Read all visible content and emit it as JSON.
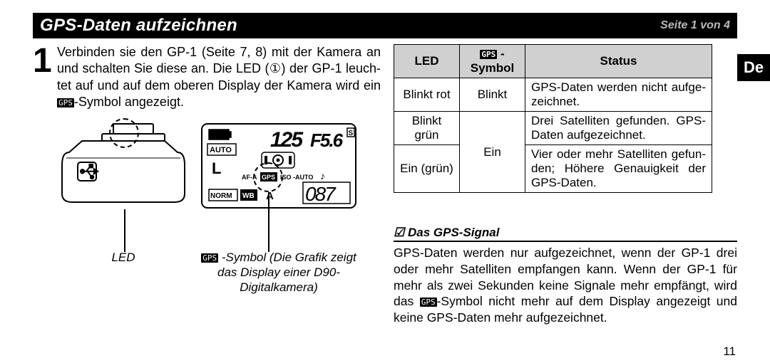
{
  "header": {
    "title": "GPS-Daten aufzeichnen",
    "page_indicator": "Seite 1 von 4"
  },
  "lang_tab": "De",
  "step": {
    "number": "1",
    "text": "Verbinden sie den GP-1 (Seite 7, 8) mit der Kamera an und schalten Sie diese an. Die LED (①) der GP-1 leuch­tet auf und auf dem oberen Display der Kamera wird ein ",
    "text_after": "-Symbol angezeigt."
  },
  "captions": {
    "led": "LED",
    "lcd": " -Symbol (Die Grafik zeigt das Display einer D90-Digitalkamera)"
  },
  "table": {
    "headers": {
      "led": "LED",
      "symbol": " -Symbol",
      "status": "Status"
    },
    "rows": [
      {
        "led": "Blinkt rot",
        "symbol": "Blinkt",
        "status": "GPS-Daten werden nicht aufge­zeichnet."
      },
      {
        "led": "Blinkt grün",
        "symbol": "Ein",
        "status": "Drei Satelliten gefunden. GPS-Daten aufgezeichnet."
      },
      {
        "led": "Ein (grün)",
        "symbol": "",
        "status": "Vier oder mehr Satelliten gefun­den; Höhere Genauigkeit der GPS-Daten."
      }
    ]
  },
  "note": {
    "title": " Das GPS-Signal",
    "body_before": "GPS-Daten werden nur aufgezeichnet, wenn der GP-1 drei oder mehr Satelliten empfangen kann. Wenn der GP-1 für mehr als zwei Sekunden keine Signale mehr empfängt, wird das ",
    "body_after": "-Symbol nicht mehr auf dem Display angezeigt und keine GPS-Daten mehr aufgezeichnet."
  },
  "page_number": "11",
  "icons": {
    "gps_chip": "GPS",
    "check": "☑"
  },
  "chart_data": {
    "type": "table",
    "title": "GPS LED/Symbol status",
    "columns": [
      "LED",
      "GPS-Symbol",
      "Status"
    ],
    "rows": [
      [
        "Blinkt rot",
        "Blinkt",
        "GPS-Daten werden nicht aufgezeichnet."
      ],
      [
        "Blinkt grün",
        "Ein",
        "Drei Satelliten gefunden. GPS-Daten aufgezeichnet."
      ],
      [
        "Ein (grün)",
        "Ein",
        "Vier oder mehr Satelliten gefunden; Höhere Genauigkeit der GPS-Daten."
      ]
    ]
  }
}
